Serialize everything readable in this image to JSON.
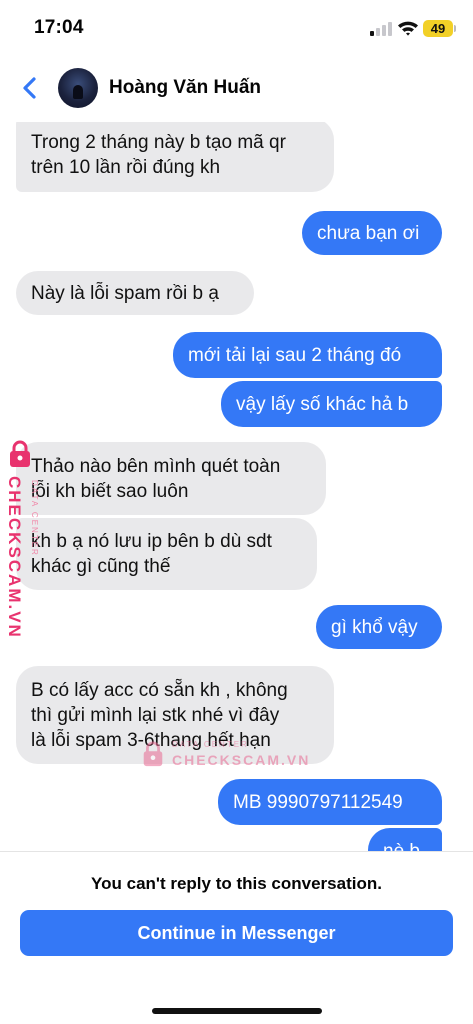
{
  "status_bar": {
    "time": "17:04",
    "battery": "49",
    "icons": [
      "cellular-signal-icon",
      "wifi-icon",
      "battery-icon"
    ]
  },
  "header": {
    "back_icon": "chevron-left-icon",
    "contact_name": "Hoàng Văn Huấn"
  },
  "messages": [
    {
      "direction": "in",
      "lines": [
        "Trong 2 tháng này b tạo mã qr",
        "trên 10 lần rồi đúng kh"
      ]
    },
    {
      "direction": "out",
      "lines": [
        "chưa bạn ơi"
      ]
    },
    {
      "direction": "in",
      "lines": [
        "Này là lỗi spam rồi b ạ"
      ]
    },
    {
      "direction": "out",
      "lines": [
        "mới tải lại sau 2 tháng đó"
      ]
    },
    {
      "direction": "out",
      "lines": [
        "vậy lấy số khác hả b"
      ]
    },
    {
      "direction": "in",
      "lines": [
        "Thảo nào bên mình quét toàn",
        "lỗi kh biết sao luôn"
      ]
    },
    {
      "direction": "in",
      "lines": [
        "kh b ạ nó lưu ip bên b dù sdt",
        "khác gì cũng thế"
      ]
    },
    {
      "direction": "out",
      "lines": [
        "gì khổ vậy"
      ]
    },
    {
      "direction": "in",
      "lines": [
        "B có lấy acc có sẵn kh , không",
        "thì gửi mình lại stk nhé vì đây",
        "là lỗi spam 3-6thang hết hạn"
      ]
    },
    {
      "direction": "out",
      "lines": [
        "MB 9990797112549"
      ]
    },
    {
      "direction": "out",
      "lines": [
        "nè b"
      ]
    }
  ],
  "watermarks": {
    "side_text": "CHECKSCAM.VN",
    "side_sub": "DATA CENTER",
    "center_small": "DATA CENTER",
    "center_big": "CHECKSCAM.VN",
    "color": "#e8336e"
  },
  "footer": {
    "notice": "You can't reply to this conversation.",
    "button_label": "Continue in Messenger"
  },
  "colors": {
    "accent": "#3478f6",
    "incoming_bubble": "#e9e9eb",
    "battery": "#f2d027"
  }
}
